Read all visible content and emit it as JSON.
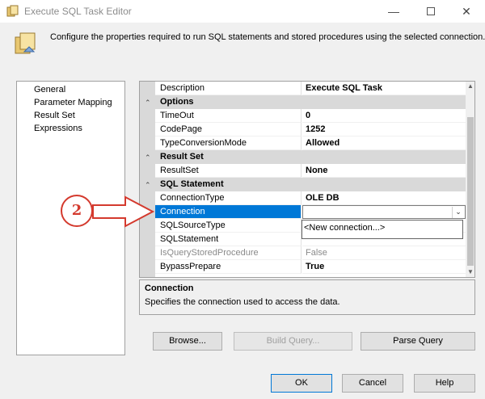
{
  "window": {
    "title": "Execute SQL Task Editor",
    "minimize_glyph": "—",
    "close_glyph": "✕"
  },
  "header": {
    "description": "Configure the properties required to run SQL statements and stored procedures using the selected connection."
  },
  "nav": {
    "items": [
      "General",
      "Parameter Mapping",
      "Result Set",
      "Expressions"
    ]
  },
  "grid": {
    "collapse_glyph": "⌃",
    "dropdown_glyph": "⌄",
    "rows": [
      {
        "kind": "property",
        "name": "Description",
        "value": "Execute SQL Task"
      },
      {
        "kind": "category",
        "name": "Options"
      },
      {
        "kind": "property",
        "name": "TimeOut",
        "value": "0"
      },
      {
        "kind": "property",
        "name": "CodePage",
        "value": "1252"
      },
      {
        "kind": "property",
        "name": "TypeConversionMode",
        "value": "Allowed"
      },
      {
        "kind": "category",
        "name": "Result Set"
      },
      {
        "kind": "property",
        "name": "ResultSet",
        "value": "None"
      },
      {
        "kind": "category",
        "name": "SQL Statement"
      },
      {
        "kind": "property",
        "name": "ConnectionType",
        "value": "OLE DB"
      },
      {
        "kind": "property",
        "name": "Connection",
        "value": "",
        "selected": true
      },
      {
        "kind": "property",
        "name": "SQLSourceType",
        "value": ""
      },
      {
        "kind": "property",
        "name": "SQLStatement",
        "value": ""
      },
      {
        "kind": "property",
        "name": "IsQueryStoredProcedure",
        "value": "False",
        "disabled": true
      },
      {
        "kind": "property",
        "name": "BypassPrepare",
        "value": "True"
      }
    ],
    "dropdown_option": "<New connection...>"
  },
  "description_panel": {
    "title": "Connection",
    "text": "Specifies the connection used to access the data."
  },
  "buttons": {
    "browse": "Browse...",
    "build_query": "Build Query...",
    "parse_query": "Parse Query",
    "ok": "OK",
    "cancel": "Cancel",
    "help": "Help"
  },
  "annotation": {
    "number": "2"
  },
  "colors": {
    "selection": "#0078d7",
    "annotation_red": "#d43a2e",
    "category_bg": "#d9d9d9"
  }
}
